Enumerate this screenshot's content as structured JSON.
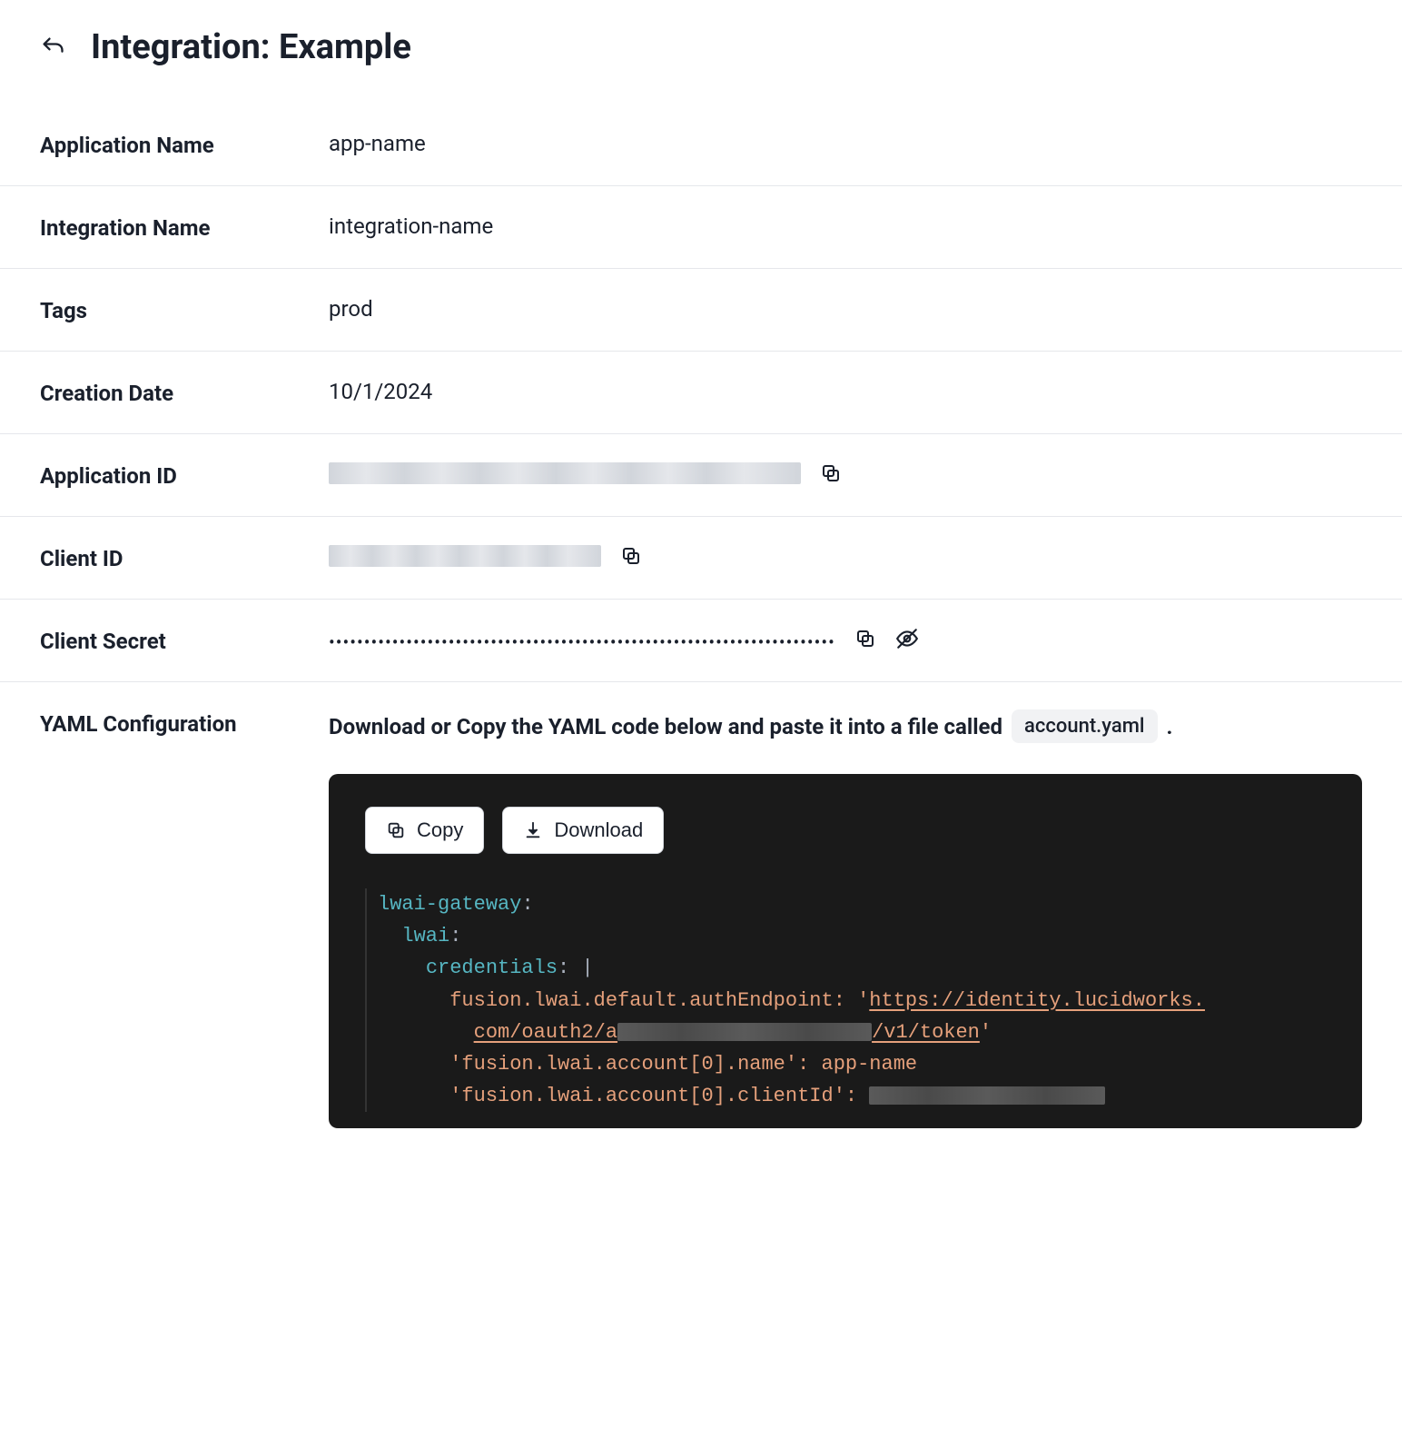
{
  "header": {
    "title": "Integration: Example"
  },
  "fields": {
    "app_name_label": "Application Name",
    "app_name_value": "app-name",
    "integration_name_label": "Integration Name",
    "integration_name_value": "integration-name",
    "tags_label": "Tags",
    "tags_value": "prod",
    "creation_date_label": "Creation Date",
    "creation_date_value": "10/1/2024",
    "application_id_label": "Application ID",
    "client_id_label": "Client ID",
    "client_secret_label": "Client Secret",
    "client_secret_masked": "••••••••••••••••••••••••••••••••••••••••••••••••••••••••••••••••••••••••"
  },
  "yaml": {
    "label": "YAML Configuration",
    "instruction": "Download or Copy the YAML code below and paste it into a file called",
    "filename": "account.yaml",
    "copy_label": "Copy",
    "download_label": "Download",
    "code": {
      "l1_key": "lwai-gateway",
      "l2_key": "lwai",
      "l3_key": "credentials",
      "l4a": "fusion.lwai.default.authEndpoint: ",
      "l4b_url1": "https://identity.lucidworks.",
      "l5_url2": "com/oauth2/a",
      "l5_url3": "/v1/token",
      "l6": "'fusion.lwai.account[0].name': app-name",
      "l7": "'fusion.lwai.account[0].clientId': "
    }
  }
}
